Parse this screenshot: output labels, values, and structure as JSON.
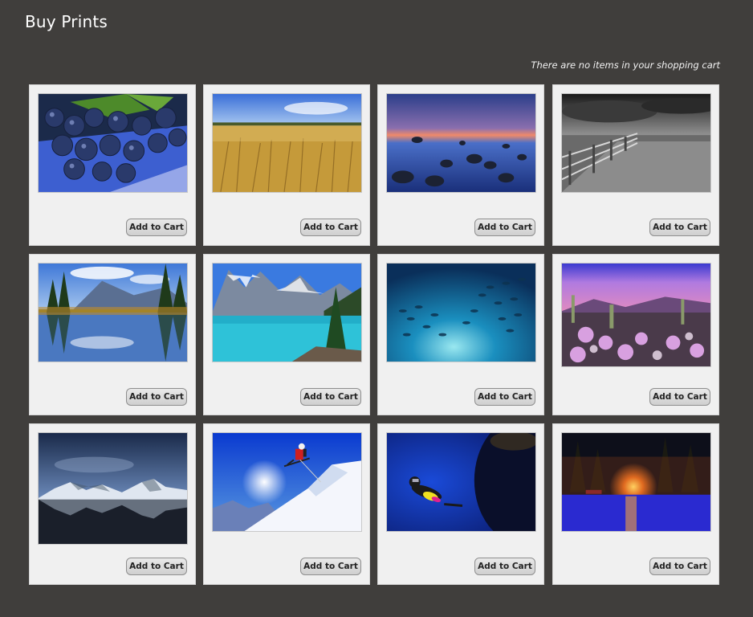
{
  "header": {
    "title": "Buy Prints",
    "cart_status": "There are no items in your shopping cart"
  },
  "products": [
    {
      "name": "blueberries",
      "button_label": "Add to Cart"
    },
    {
      "name": "wheat-field",
      "button_label": "Add to Cart"
    },
    {
      "name": "rocky-shore-dusk",
      "button_label": "Add to Cart"
    },
    {
      "name": "fence-black-white",
      "button_label": "Add to Cart"
    },
    {
      "name": "mountain-lake-reflection",
      "button_label": "Add to Cart"
    },
    {
      "name": "moraine-lake",
      "button_label": "Add to Cart"
    },
    {
      "name": "fish-school",
      "button_label": "Add to Cart"
    },
    {
      "name": "desert-flowers",
      "button_label": "Add to Cart"
    },
    {
      "name": "snowy-peaks-reflection",
      "button_label": "Add to Cart"
    },
    {
      "name": "skier-jump",
      "button_label": "Add to Cart"
    },
    {
      "name": "scuba-diver",
      "button_label": "Add to Cart"
    },
    {
      "name": "campfire-lake-night",
      "button_label": "Add to Cart"
    }
  ]
}
